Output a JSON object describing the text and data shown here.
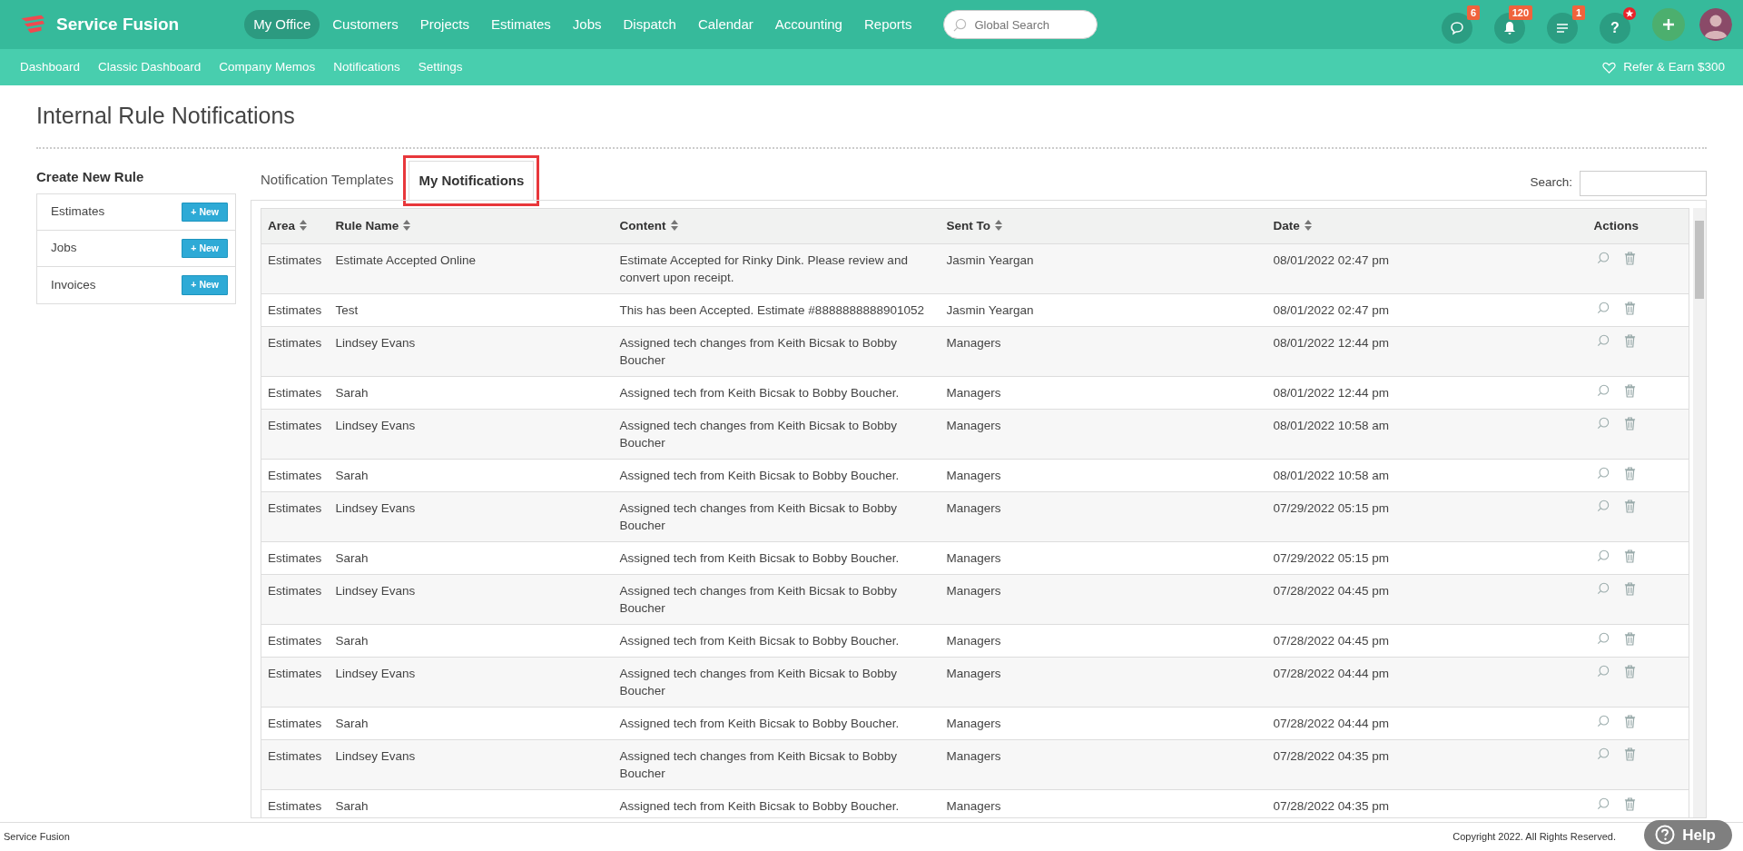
{
  "brand": {
    "name": "Service Fusion"
  },
  "main_nav": [
    {
      "label": "My Office",
      "selected": true
    },
    {
      "label": "Customers",
      "selected": false
    },
    {
      "label": "Projects",
      "selected": false
    },
    {
      "label": "Estimates",
      "selected": false
    },
    {
      "label": "Jobs",
      "selected": false
    },
    {
      "label": "Dispatch",
      "selected": false
    },
    {
      "label": "Calendar",
      "selected": false
    },
    {
      "label": "Accounting",
      "selected": false
    },
    {
      "label": "Reports",
      "selected": false
    }
  ],
  "global_search": {
    "placeholder": "Global Search"
  },
  "header_icons": [
    {
      "kind": "chat",
      "badge": "6"
    },
    {
      "kind": "bell",
      "badge": "120"
    },
    {
      "kind": "list",
      "badge": "1"
    },
    {
      "kind": "help",
      "label": "?",
      "star_badge": true
    }
  ],
  "sub_nav": [
    "Dashboard",
    "Classic Dashboard",
    "Company Memos",
    "Notifications",
    "Settings"
  ],
  "refer_link": "Refer & Earn $300",
  "page_title": "Internal Rule Notifications",
  "create_rule": {
    "title": "Create New Rule",
    "items": [
      {
        "label": "Estimates",
        "button": "+ New"
      },
      {
        "label": "Jobs",
        "button": "+ New"
      },
      {
        "label": "Invoices",
        "button": "+ New"
      }
    ]
  },
  "tabs": [
    {
      "label": "Notification Templates",
      "selected": false,
      "highlighted": false
    },
    {
      "label": "My Notifications",
      "selected": true,
      "highlighted": true
    }
  ],
  "search": {
    "label": "Search:"
  },
  "table": {
    "columns": [
      {
        "label": "Area",
        "sortable": true
      },
      {
        "label": "Rule Name",
        "sortable": true
      },
      {
        "label": "Content",
        "sortable": true
      },
      {
        "label": "Sent To",
        "sortable": true
      },
      {
        "label": "Date",
        "sortable": true
      },
      {
        "label": "Actions",
        "sortable": false
      }
    ],
    "rows": [
      {
        "area": "Estimates",
        "rule_name": "Estimate Accepted Online",
        "content": "Estimate Accepted for Rinky Dink. Please review and convert upon receipt.",
        "sent_to": "Jasmin Yeargan",
        "date": "08/01/2022 02:47 pm"
      },
      {
        "area": "Estimates",
        "rule_name": "Test",
        "content": "This has been Accepted. Estimate #8888888888901052",
        "sent_to": "Jasmin Yeargan",
        "date": "08/01/2022 02:47 pm"
      },
      {
        "area": "Estimates",
        "rule_name": "Lindsey Evans",
        "content": "Assigned tech changes from Keith Bicsak to Bobby Boucher",
        "sent_to": "Managers",
        "date": "08/01/2022 12:44 pm"
      },
      {
        "area": "Estimates",
        "rule_name": "Sarah",
        "content": "Assigned tech from Keith Bicsak to Bobby Boucher.",
        "sent_to": "Managers",
        "date": "08/01/2022 12:44 pm"
      },
      {
        "area": "Estimates",
        "rule_name": "Lindsey Evans",
        "content": "Assigned tech changes from Keith Bicsak to Bobby Boucher",
        "sent_to": "Managers",
        "date": "08/01/2022 10:58 am"
      },
      {
        "area": "Estimates",
        "rule_name": "Sarah",
        "content": "Assigned tech from Keith Bicsak to Bobby Boucher.",
        "sent_to": "Managers",
        "date": "08/01/2022 10:58 am"
      },
      {
        "area": "Estimates",
        "rule_name": "Lindsey Evans",
        "content": "Assigned tech changes from Keith Bicsak to Bobby Boucher",
        "sent_to": "Managers",
        "date": "07/29/2022 05:15 pm"
      },
      {
        "area": "Estimates",
        "rule_name": "Sarah",
        "content": "Assigned tech from Keith Bicsak to Bobby Boucher.",
        "sent_to": "Managers",
        "date": "07/29/2022 05:15 pm"
      },
      {
        "area": "Estimates",
        "rule_name": "Lindsey Evans",
        "content": "Assigned tech changes from Keith Bicsak to Bobby Boucher",
        "sent_to": "Managers",
        "date": "07/28/2022 04:45 pm"
      },
      {
        "area": "Estimates",
        "rule_name": "Sarah",
        "content": "Assigned tech from Keith Bicsak to Bobby Boucher.",
        "sent_to": "Managers",
        "date": "07/28/2022 04:45 pm"
      },
      {
        "area": "Estimates",
        "rule_name": "Lindsey Evans",
        "content": "Assigned tech changes from Keith Bicsak to Bobby Boucher",
        "sent_to": "Managers",
        "date": "07/28/2022 04:44 pm"
      },
      {
        "area": "Estimates",
        "rule_name": "Sarah",
        "content": "Assigned tech from Keith Bicsak to Bobby Boucher.",
        "sent_to": "Managers",
        "date": "07/28/2022 04:44 pm"
      },
      {
        "area": "Estimates",
        "rule_name": "Lindsey Evans",
        "content": "Assigned tech changes from Keith Bicsak to Bobby Boucher",
        "sent_to": "Managers",
        "date": "07/28/2022 04:35 pm"
      },
      {
        "area": "Estimates",
        "rule_name": "Sarah",
        "content": "Assigned tech from Keith Bicsak to Bobby Boucher.",
        "sent_to": "Managers",
        "date": "07/28/2022 04:35 pm"
      }
    ]
  },
  "footer": {
    "left": "Service Fusion",
    "right": "Copyright 2022. All Rights Reserved."
  },
  "help_button": {
    "label": "Help"
  }
}
